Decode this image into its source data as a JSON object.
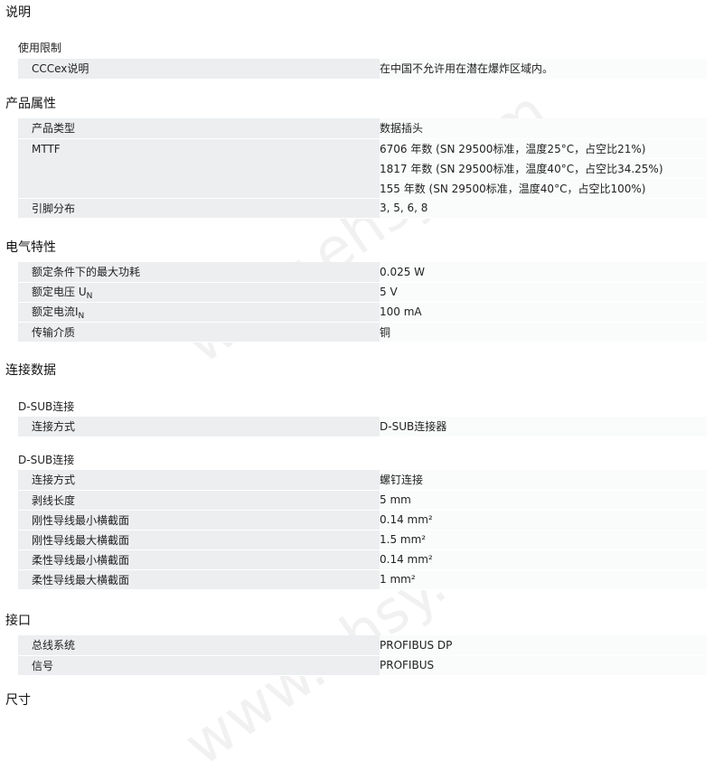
{
  "watermark": "www.ehsy.com",
  "sections": {
    "description": {
      "title": "说明",
      "subtitle": "使用限制",
      "rows": [
        {
          "label": "CCCex说明",
          "values": [
            "在中国不允许用在潜在爆炸区域内。"
          ]
        }
      ]
    },
    "product": {
      "title": "产品属性",
      "rows": [
        {
          "label": "产品类型",
          "values": [
            "数据插头"
          ]
        },
        {
          "label": "MTTF",
          "values": [
            "6706 年数 (SN 29500标准，温度25°C，占空比21%)",
            "1817 年数 (SN 29500标准，温度40°C，占空比34.25%)",
            "155 年数 (SN 29500标准，温度40°C，占空比100%)"
          ]
        },
        {
          "label": "引脚分布",
          "values": [
            "3, 5, 6, 8"
          ]
        }
      ]
    },
    "electrical": {
      "title": "电气特性",
      "rows": [
        {
          "label": "额定条件下的最大功耗",
          "values": [
            "0.025 W"
          ]
        },
        {
          "label_main": "额定电压 U",
          "label_sub": "N",
          "values": [
            "5 V"
          ]
        },
        {
          "label_main": "额定电流I",
          "label_sub": "N",
          "values": [
            "100 mA"
          ]
        },
        {
          "label": "传输介质",
          "values": [
            "铜"
          ]
        }
      ]
    },
    "connection": {
      "title": "连接数据",
      "group1": {
        "subtitle": "D-SUB连接",
        "rows": [
          {
            "label": "连接方式",
            "values": [
              "D-SUB连接器"
            ]
          }
        ]
      },
      "group2": {
        "subtitle": "D-SUB连接",
        "rows": [
          {
            "label": "连接方式",
            "values": [
              "螺钉连接"
            ]
          },
          {
            "label": "剥线长度",
            "values": [
              "5 mm"
            ]
          },
          {
            "label": "刚性导线最小横截面",
            "values": [
              "0.14 mm²"
            ]
          },
          {
            "label": "刚性导线最大横截面",
            "values": [
              "1.5 mm²"
            ]
          },
          {
            "label": "柔性导线最小横截面",
            "values": [
              "0.14 mm²"
            ]
          },
          {
            "label": "柔性导线最大横截面",
            "values": [
              "1 mm²"
            ]
          }
        ]
      }
    },
    "interface": {
      "title": "接口",
      "rows": [
        {
          "label": "总线系统",
          "values": [
            "PROFIBUS DP"
          ]
        },
        {
          "label": "信号",
          "values": [
            "PROFIBUS"
          ]
        }
      ]
    },
    "dimensions": {
      "title": "尺寸"
    }
  }
}
